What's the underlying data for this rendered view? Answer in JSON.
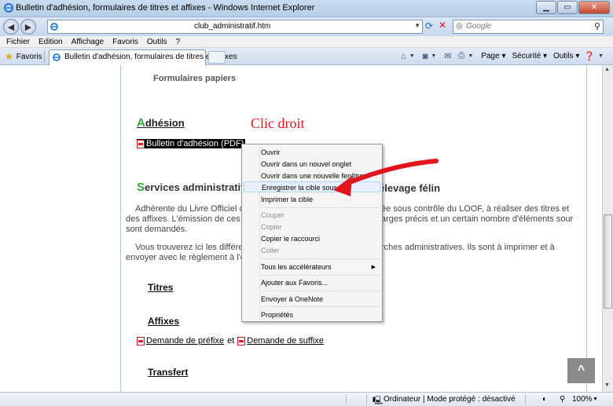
{
  "window": {
    "title": "Bulletin d'adhésion, formulaires de titres et affixes - Windows Internet Explorer"
  },
  "address": {
    "url_suffix": "club_administratif.htm"
  },
  "search": {
    "placeholder": "Google"
  },
  "menu": [
    "Fichier",
    "Edition",
    "Affichage",
    "Favoris",
    "Outils",
    "?"
  ],
  "favorites_label": "Favoris",
  "tab": {
    "label": "Bulletin d'adhésion, formulaires de titres et affixes"
  },
  "commands": {
    "page": "Page",
    "security": "Sécurité",
    "tools": "Outils"
  },
  "page": {
    "section_title": "Formulaires papiers",
    "adhesion": {
      "first": "A",
      "rest": "dhésion"
    },
    "adhesion_link": "Bulletin d'adhésion (PDF)",
    "annotation": "Clic droit",
    "services": {
      "first": "S",
      "rest": "ervices administratifs",
      "tail": "élevage félin"
    },
    "para1": {
      "l1a": "Adhérente du Livre Officiel d",
      "l1b": "ée sous contrôle du LOOF, à réaliser des titres et",
      "l2a": "des affixes. L'émission de ces",
      "l2b": "arges précis et un certain nombre d'éléments sour",
      "l3": "sont demandés."
    },
    "para2": {
      "l1a": "Vous trouverez ici les différe",
      "l1b": "rches administratives. Ils sont à imprimer et à",
      "l2": "envoyer avec le règlement à l'o"
    },
    "titres": "Titres",
    "affixes": "Affixes",
    "prefix_link": "Demande de préfixe",
    "and": "et",
    "suffix_link": "Demande de suffixe",
    "transfert": "Transfert",
    "back_to_top": "^"
  },
  "context_menu": {
    "items": [
      {
        "label": "Ouvrir",
        "enabled": true
      },
      {
        "label": "Ouvrir dans un nouvel onglet",
        "enabled": true
      },
      {
        "label": "Ouvrir dans une nouvelle fenêtre",
        "enabled": true
      },
      {
        "label": "Enregistrer la cible sous...",
        "enabled": true,
        "highlighted": true
      },
      {
        "label": "Imprimer la cible",
        "enabled": true
      },
      {
        "label": "Couper",
        "enabled": false
      },
      {
        "label": "Copier",
        "enabled": false
      },
      {
        "label": "Copier le raccourci",
        "enabled": true
      },
      {
        "label": "Coller",
        "enabled": false
      },
      {
        "label": "Tous les accélérateurs",
        "enabled": true,
        "submenu": true
      },
      {
        "label": "Ajouter aux Favoris...",
        "enabled": true
      },
      {
        "label": "Envoyer à OneNote",
        "enabled": true
      },
      {
        "label": "Propriétés",
        "enabled": true
      }
    ]
  },
  "status": {
    "zone": "Ordinateur | Mode protégé : désactivé",
    "zoom": "100%"
  },
  "colors": {
    "annotation": "#e0161c",
    "heading_initial": "#3aa33a"
  }
}
